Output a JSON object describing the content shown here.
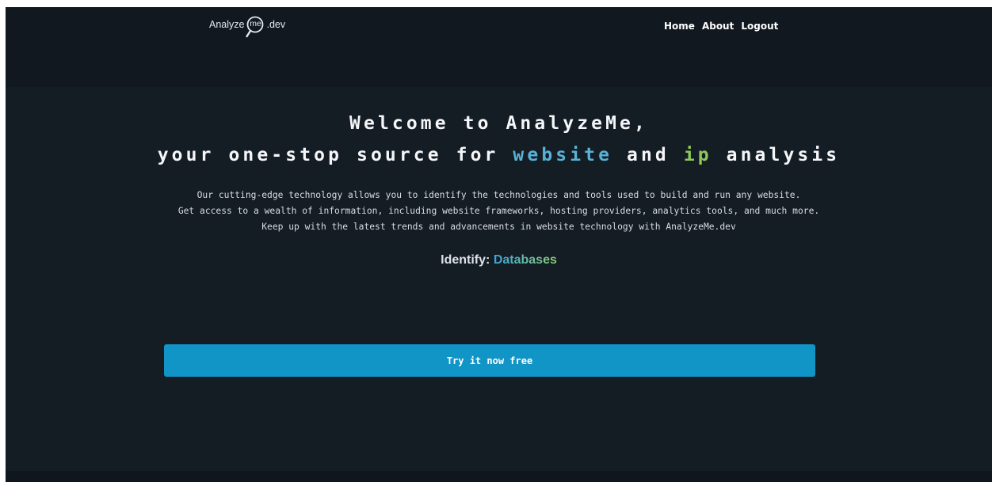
{
  "navbar": {
    "logo_prefix": "Analyze",
    "logo_mark_text": "me",
    "logo_suffix": ".dev",
    "links": [
      {
        "label": "Home"
      },
      {
        "label": "About"
      },
      {
        "label": "Logout"
      }
    ]
  },
  "hero": {
    "title_line1": "Welcome to AnalyzeMe,",
    "title_line2_part1": "your one-stop source for ",
    "title_line2_highlight1": "website",
    "title_line2_part2": " and ",
    "title_line2_highlight2": "ip",
    "title_line2_part3": " analysis",
    "description": [
      "Our cutting-edge technology allows you to identify the technologies and tools used to build and run any website.",
      "Get access to a wealth of information, including website frameworks, hosting providers, analytics tools, and much more.",
      "Keep up with the latest trends and advancements in website technology with AnalyzeMe.dev"
    ],
    "identify_label": "Identify:",
    "identify_value": "Databases",
    "cta_label": "Try it now free"
  },
  "colors": {
    "page_background": "#141c24",
    "navbar_background": "#111820",
    "highlight_website": "#58b2d6",
    "highlight_ip": "#8ec95a",
    "cta_background": "#1194c6"
  },
  "icons": {
    "logo_mark": "magnifier-icon"
  }
}
